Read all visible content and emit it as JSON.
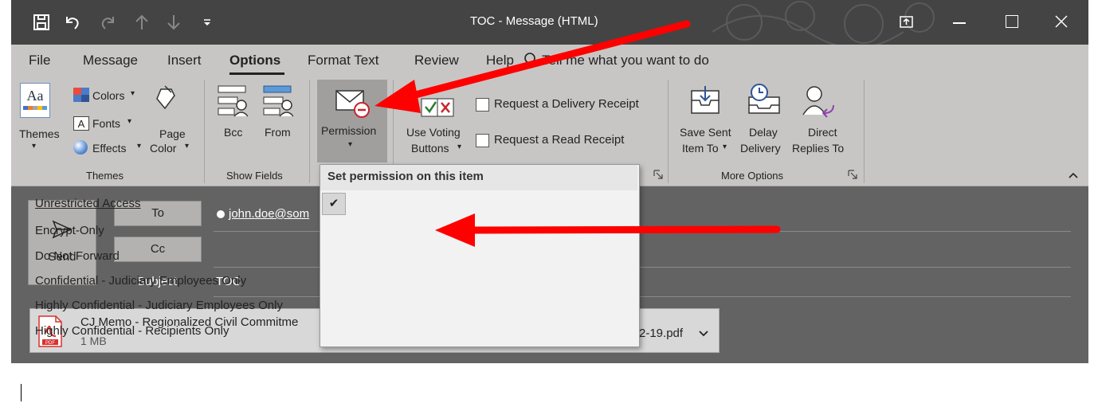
{
  "title_bar": {
    "title": "TOC  -  Message (HTML)",
    "qat_icons": [
      "save-icon",
      "undo-icon",
      "redo-icon",
      "up-arrow-icon",
      "down-arrow-icon",
      "customize-qat-icon"
    ],
    "window_buttons": [
      "ribbon-display-options-icon",
      "minimize-icon",
      "maximize-icon",
      "close-icon"
    ]
  },
  "tabs": [
    "File",
    "Message",
    "Insert",
    "Options",
    "Format Text",
    "Review",
    "Help"
  ],
  "active_tab": "Options",
  "tell_me": "Tell me what you want to do",
  "ribbon": {
    "themes": {
      "themes_label": "Themes",
      "colors": "Colors",
      "fonts": "Fonts",
      "effects": "Effects",
      "page_color_line1": "Page",
      "page_color_line2": "Color",
      "group": "Themes"
    },
    "show_fields": {
      "bcc": "Bcc",
      "from": "From",
      "group": "Show Fields"
    },
    "permission": {
      "label": "Permission"
    },
    "tracking": {
      "voting_line1": "Use Voting",
      "voting_line2": "Buttons",
      "delivery_receipt": "Request a Delivery Receipt",
      "read_receipt": "Request a Read Receipt"
    },
    "more_options": {
      "save_sent_line1": "Save Sent",
      "save_sent_line2": "Item To",
      "delay_line1": "Delay",
      "delay_line2": "Delivery",
      "direct_line1": "Direct",
      "direct_line2": "Replies To",
      "group": "More Options"
    }
  },
  "compose": {
    "send": "Send",
    "to": "To",
    "cc": "Cc",
    "subject_label": "Subject",
    "to_value": "john.doe@som",
    "subject_value": "TOC",
    "attachment": {
      "name_start": "CJ Memo - Regionalized Civil Commitme",
      "name_end": "2-19.pdf",
      "size": "1 MB"
    }
  },
  "permission_menu": {
    "header": "Set permission on this item",
    "items": [
      "Unrestricted Access",
      "Encrypt-Only",
      "Do Not Forward",
      "Confidential - Judiciary Employees Only",
      "Highly Confidential - Judiciary Employees Only",
      "Highly Confidential - Recipients Only"
    ],
    "checked": "Unrestricted Access"
  },
  "colors": {
    "titlebar": "#444444",
    "ribbon": "#c8c6c4",
    "header": "#636363",
    "annotation_arrow": "#ff0000",
    "pdf_red": "#d9302c"
  }
}
